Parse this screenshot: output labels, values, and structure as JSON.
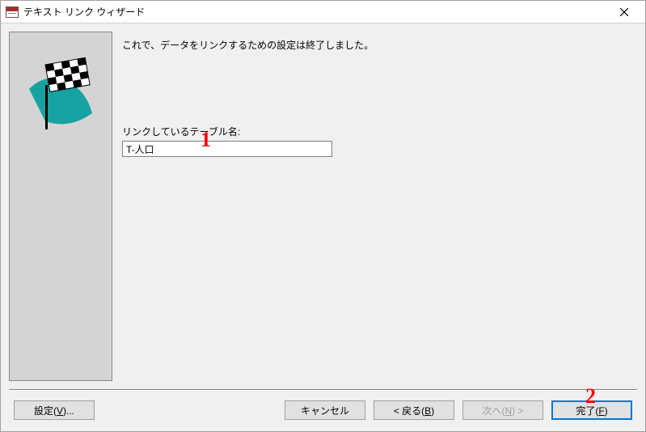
{
  "titlebar": {
    "title": "テキスト リンク ウィザード"
  },
  "content": {
    "intro": "これで、データをリンクするための設定は終了しました。",
    "table_name_label": "リンクしているテーブル名:",
    "table_name_value": "T-人口"
  },
  "buttons": {
    "settings": "設定(V)...",
    "cancel": "キャンセル",
    "back": "< 戻る(B)",
    "next": "次へ(N) >",
    "finish": "完了(F)",
    "settings_key": "V",
    "back_key": "B",
    "next_key": "N",
    "finish_key": "F"
  },
  "annotations": {
    "a1": "1",
    "a2": "2"
  }
}
